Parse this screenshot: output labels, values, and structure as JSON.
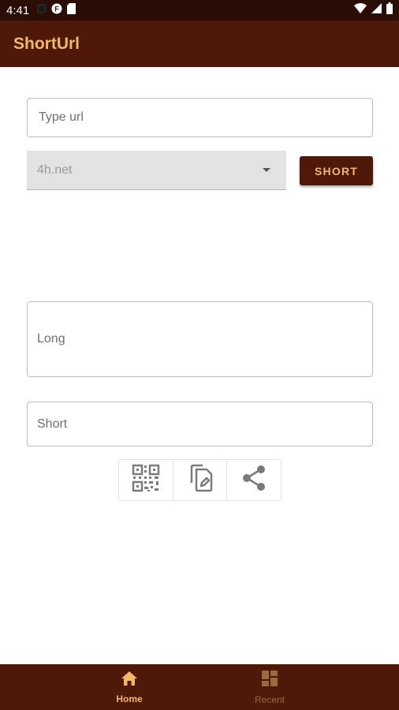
{
  "status_bar": {
    "time": "4:41",
    "left_icons": [
      "dot-icon",
      "circle-f-icon",
      "sd-card-icon"
    ],
    "right_icons": [
      "wifi-icon",
      "signal-icon",
      "battery-icon"
    ]
  },
  "app_bar": {
    "title": "ShortUrl"
  },
  "form": {
    "url_placeholder": "Type url",
    "url_value": "",
    "domain_selected": "4h.net",
    "short_button_label": "SHORT",
    "long_label": "Long",
    "short_label": "Short"
  },
  "actions": [
    {
      "name": "qr-code-icon"
    },
    {
      "name": "copy-icon"
    },
    {
      "name": "share-icon"
    }
  ],
  "bottom_nav": {
    "items": [
      {
        "label": "Home",
        "icon": "home-icon",
        "active": true
      },
      {
        "label": "Recent",
        "icon": "grid-icon",
        "active": false
      }
    ]
  },
  "colors": {
    "status_bar": "#2a0d04",
    "primary": "#4e1909",
    "accent": "#f2b86a",
    "inactive_nav": "#9a6a3c"
  }
}
